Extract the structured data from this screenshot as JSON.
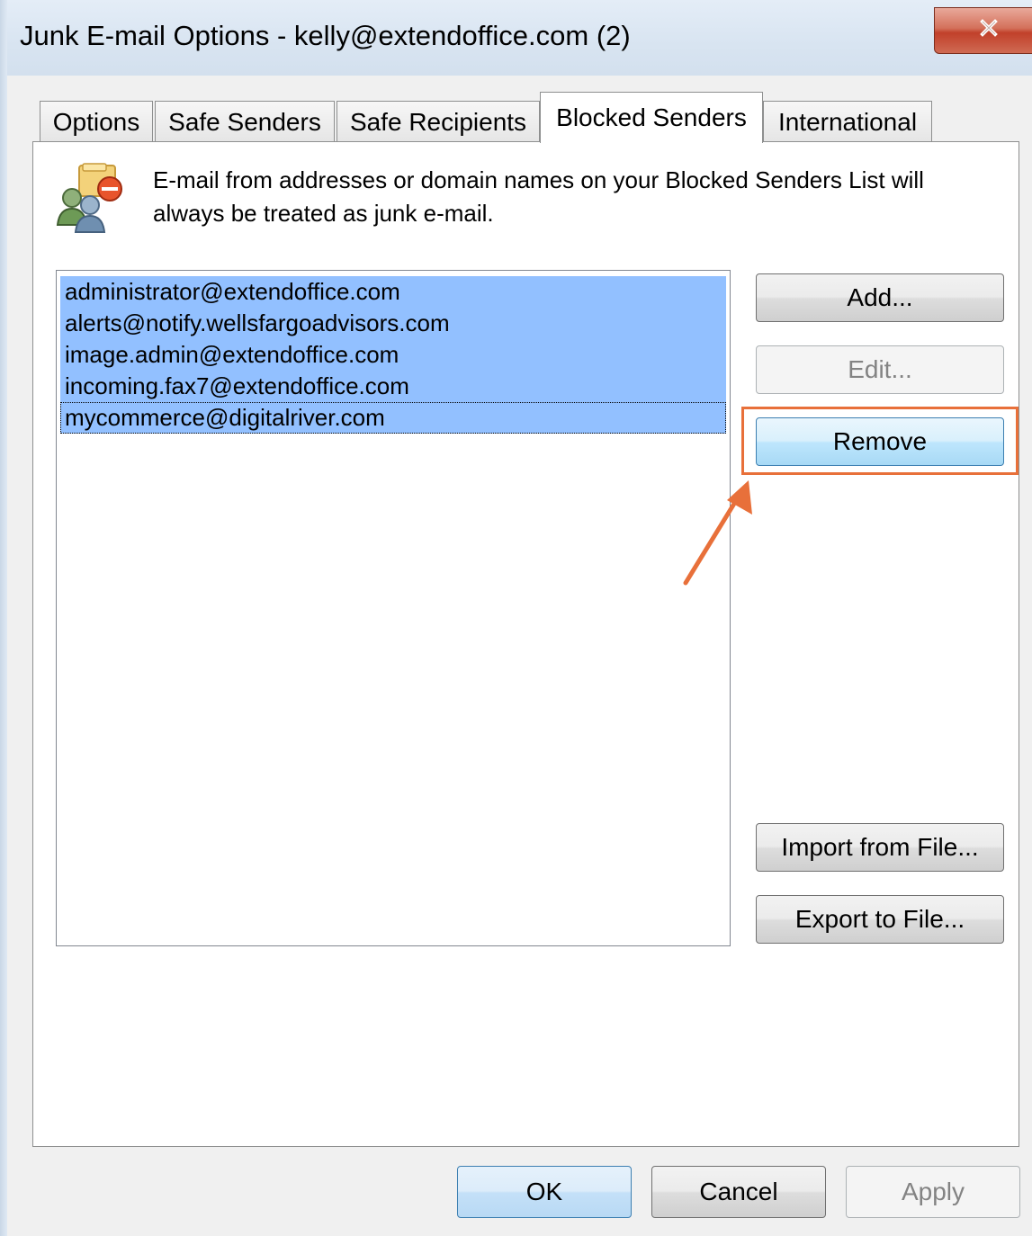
{
  "window": {
    "title": "Junk E-mail Options - kelly@extendoffice.com (2)",
    "close_icon": "close-x-icon"
  },
  "tabs": [
    {
      "label": "Options",
      "active": false
    },
    {
      "label": "Safe Senders",
      "active": false
    },
    {
      "label": "Safe Recipients",
      "active": false
    },
    {
      "label": "Blocked Senders",
      "active": true
    },
    {
      "label": "International",
      "active": false
    }
  ],
  "description": {
    "icon": "blocked-senders-icon",
    "text": "E-mail from addresses or domain names on your Blocked Senders List will always be treated as junk e-mail."
  },
  "blocked_list": {
    "items": [
      "administrator@extendoffice.com",
      "alerts@notify.wellsfargoadvisors.com",
      "image.admin@extendoffice.com",
      "incoming.fax7@extendoffice.com",
      "mycommerce@digitalriver.com"
    ],
    "all_selected": true,
    "focused_index": 4
  },
  "side_buttons": {
    "add": "Add...",
    "edit": "Edit...",
    "remove": "Remove",
    "import": "Import from File...",
    "export": "Export to File..."
  },
  "footer_buttons": {
    "ok": "OK",
    "cancel": "Cancel",
    "apply": "Apply"
  },
  "annotation": {
    "highlight_color": "#e8703a",
    "arrow_icon": "annotation-arrow-icon"
  }
}
